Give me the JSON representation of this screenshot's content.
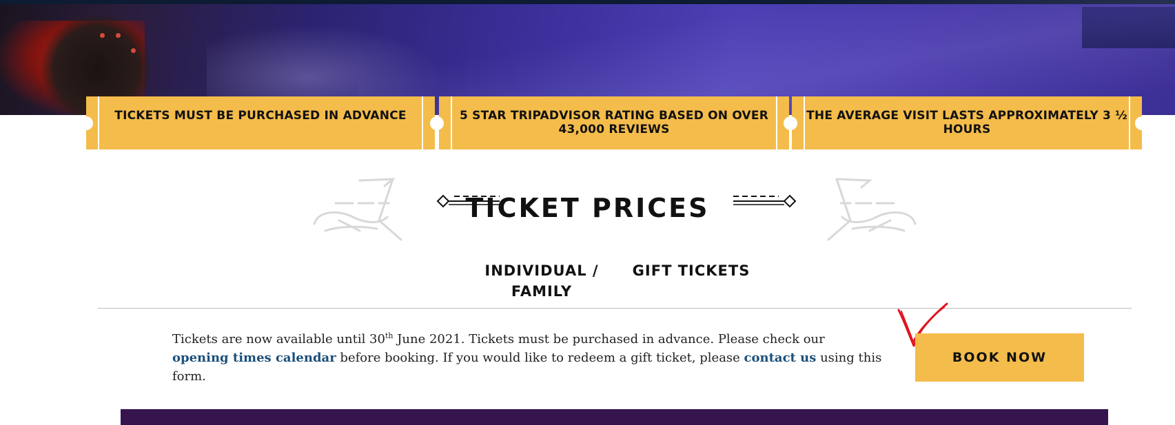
{
  "banner": {
    "items": [
      {
        "label": "TICKETS MUST BE PURCHASED IN ADVANCE"
      },
      {
        "label": "5 STAR TRIPADVISOR RATING BASED ON OVER 43,000 REVIEWS"
      },
      {
        "label": "THE AVERAGE VISIT LASTS APPROXIMATELY 3 ½ HOURS"
      }
    ]
  },
  "section": {
    "title": "TICKET PRICES"
  },
  "tabs": [
    {
      "label_line1": "INDIVIDUAL /",
      "label_line2": "FAMILY"
    },
    {
      "label_line1": "GIFT TICKETS",
      "label_line2": ""
    }
  ],
  "info": {
    "part1": "Tickets are now available until 30",
    "sup": "th",
    "part2": " June 2021. Tickets must be purchased in advance. Please check our ",
    "link1": "opening times calendar",
    "part3": " before booking. If you would like to redeem a gift ticket, please ",
    "link2": "contact us",
    "part4": " using this form."
  },
  "cta": {
    "label": "BOOK NOW"
  },
  "colors": {
    "ticket_yellow": "#f4bc4b",
    "link_blue": "#1b4f7a",
    "footer_purple": "#36154f",
    "hero_purple": "#3b2f9a",
    "checkmark_red": "#e0141e"
  },
  "icons": {
    "ornament_left": "art-deco-flourish-icon",
    "ornament_right": "art-deco-flourish-icon",
    "checkmark": "red-checkmark-annotation-icon"
  }
}
